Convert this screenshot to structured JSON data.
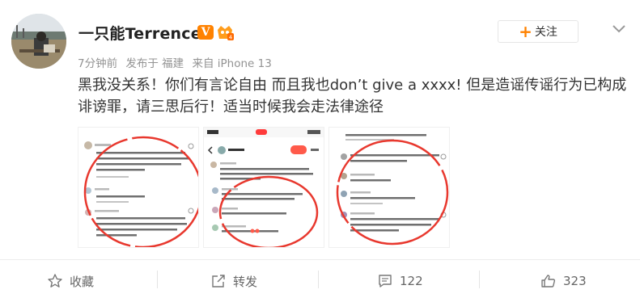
{
  "post": {
    "author": "一只能Terrence",
    "badge_v": "V",
    "meta": {
      "time": "7分钟前",
      "location": "发布于 福建",
      "source": "来自 iPhone 13"
    },
    "follow_label": "关注",
    "content": "黑我没关系！你们有言论自由 而且我也don’t give a xxxx! 但是造谣传谣行为已构成诽谤罪，请三思后行！适当时候我会走法律途径"
  },
  "actions": {
    "favorite_label": "收藏",
    "repost_label": "转发",
    "comment_count": "122",
    "like_count": "323"
  },
  "colors": {
    "accent": "#ff8200",
    "annotation_circle": "#e8382e"
  }
}
